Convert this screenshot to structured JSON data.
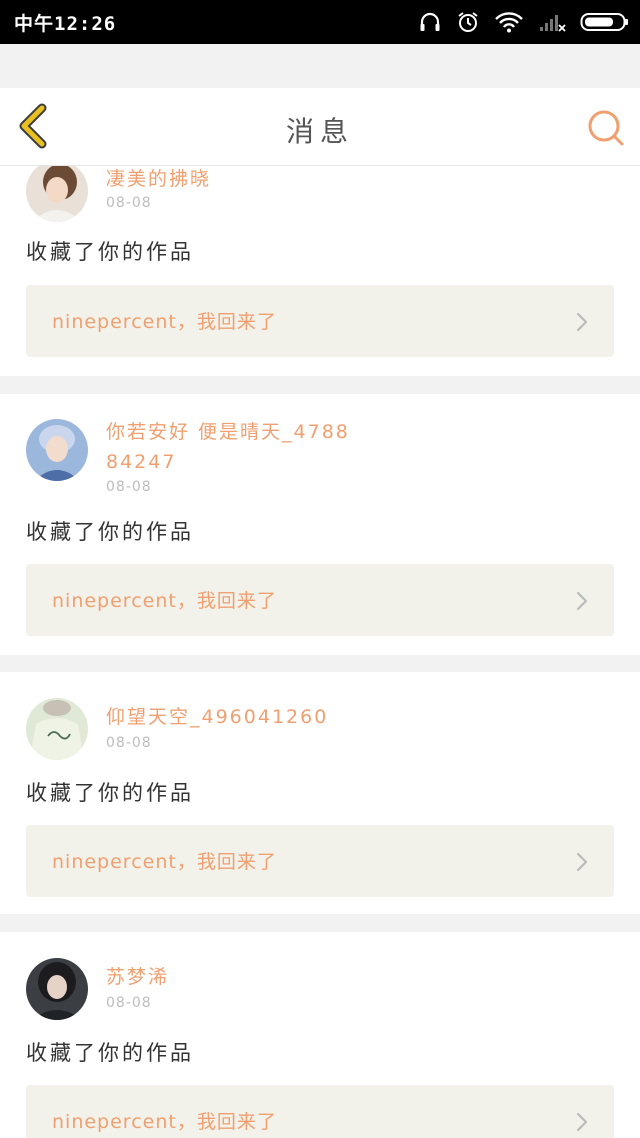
{
  "status_bar": {
    "time": "中午12:26",
    "icons": [
      "headphones-icon",
      "alarm-icon",
      "wifi-icon",
      "signal-icon",
      "battery-icon"
    ]
  },
  "nav": {
    "title": "消息",
    "back_icon": "chevron-left-icon",
    "search_icon": "search-icon",
    "accent_color": "#f0a070",
    "back_color": "#e8c020"
  },
  "messages": [
    {
      "user": "凄美的拂晓",
      "date": "08-08",
      "action": "收藏了你的作品",
      "work_title": "ninepercent，我回来了"
    },
    {
      "user": "你若安好 便是晴天_478884247",
      "date": "08-08",
      "action": "收藏了你的作品",
      "work_title": "ninepercent，我回来了"
    },
    {
      "user": "仰望天空_496041260",
      "date": "08-08",
      "action": "收藏了你的作品",
      "work_title": "ninepercent，我回来了"
    },
    {
      "user": "苏梦浠",
      "date": "08-08",
      "action": "收藏了你的作品",
      "work_title": "ninepercent，我回来了"
    }
  ]
}
